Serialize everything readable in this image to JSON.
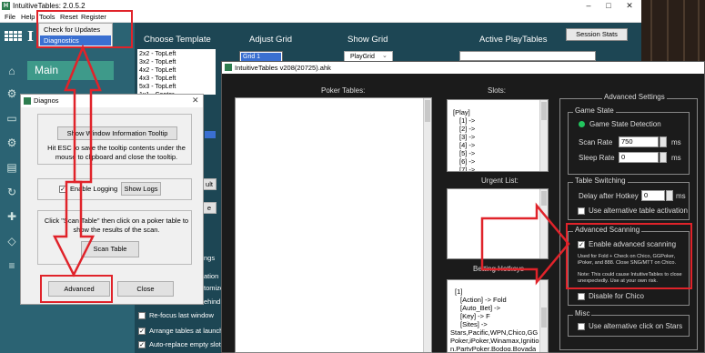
{
  "app": {
    "title": "IntuitiveTables: 2.0.5.2",
    "window_buttons": [
      "–",
      "□",
      "✕"
    ],
    "menu": [
      "File",
      "Help",
      "Tools",
      "Reset",
      "Register"
    ],
    "tools_dropdown": [
      "Check for Updates",
      "Diagnostics"
    ],
    "logo_text": "I",
    "sidebar_main": "Main",
    "sidebar_icons": [
      "home-icon",
      "gear-icon",
      "monitor-icon",
      "settings-icon",
      "document-icon",
      "refresh-icon",
      "gamepad-icon",
      "layers-icon",
      "stack-icon"
    ],
    "headers": {
      "choose_template": "Choose Template",
      "adjust_grid": "Adjust Grid",
      "show_grid": "Show Grid",
      "active_playtables": "Active PlayTables"
    },
    "session_stats": "Session Stats",
    "templates": [
      "2x2 - TopLeft",
      "3x2 - TopLeft",
      "4x2 - TopLeft",
      "4x3 - TopLeft",
      "5x3 - TopLeft",
      "1x1 - Center"
    ],
    "grid_selected": "Grid 1",
    "playgrid": "PlayGrid",
    "left_edge_snippets": [
      "ult",
      "e",
      "ngs",
      "ation",
      "tomize",
      "ehind"
    ],
    "bottom_checks": [
      {
        "label": "Re-focus last window",
        "checked": false
      },
      {
        "label": "Arrange tables at launch",
        "checked": true
      },
      {
        "label": "Auto-replace empty slots",
        "checked": true
      }
    ]
  },
  "diag": {
    "title": "Diagnos",
    "close": "✕",
    "tooltip_button": "Show Window Information Tooltip",
    "tooltip_help": "Hit ESC to save the tooltip contents under the mouse to clipboard and close the tooltip.",
    "enable_logging": "Enable Logging",
    "show_logs": "Show Logs",
    "scan_help": "Click \"Scan Table\" then click on a poker table to show the results of the scan.",
    "scan_table": "Scan Table",
    "advanced": "Advanced",
    "close_button": "Close"
  },
  "it": {
    "title": "IntuitiveTables v208(20725).ahk",
    "poker_tables": "Poker Tables:",
    "slots": "Slots:",
    "slot_lines": [
      "[Play]",
      "[1] ->",
      "[2] ->",
      "[3] ->",
      "[4] ->",
      "[5] ->",
      "[6] ->",
      "[7] ->"
    ],
    "urgent_list": "Urgent List:",
    "betting_hotkeys": "Betting Hotkeys",
    "hotkey_lines": [
      "[1]",
      "[Action] -> Fold",
      "[Auto_Bet] ->",
      "[Key] -> F",
      "[Sites] ->",
      "Stars,Pacific,WPN,Chico,GG",
      "Poker,iPoker,Winamax,Ignitio",
      "n,PartyPoker,Bodog,Bovada"
    ],
    "advanced_settings": "Advanced Settings",
    "game_state": "Game State",
    "game_state_detection": "Game State Detection",
    "scan_rate_label": "Scan Rate",
    "scan_rate": "750",
    "sleep_rate_label": "Sleep Rate",
    "sleep_rate": "0",
    "ms": "ms",
    "table_switching": "Table Switching",
    "delay_label": "Delay after Hotkey",
    "delay": "0",
    "alt_activation": "Use alternative table activation",
    "advanced_scanning": "Advanced Scanning",
    "enable_adv_scanning": "Enable advanced scanning",
    "adv_note1": "Used for Fold + Check on Chico, GGPoker, iPoker, and 888. Close SNG/MTT on Chico.",
    "adv_note2": "Note: This could cause IntuitiveTables to close unexpectedly. Use at your own risk.",
    "disable_chico": "Disable for Chico",
    "misc": "Misc",
    "alt_click": "Use alternative click on Stars",
    "status_color": "#22c55e"
  }
}
